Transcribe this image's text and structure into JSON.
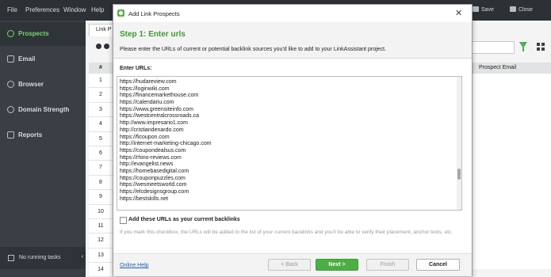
{
  "menu": {
    "file": "File",
    "preferences": "Preferences",
    "window": "Window",
    "help": "Help"
  },
  "topbar": {
    "save": "Save",
    "close": "Close"
  },
  "sidebar": {
    "items": [
      {
        "label": "Prospects",
        "icon": "prospects-icon",
        "active": true
      },
      {
        "label": "Email",
        "icon": "email-icon"
      },
      {
        "label": "Browser",
        "icon": "browser-icon"
      },
      {
        "label": "Domain Strength",
        "icon": "domain-strength-icon"
      },
      {
        "label": "Reports",
        "icon": "reports-icon"
      }
    ],
    "status": "No running tasks"
  },
  "main": {
    "tab": "Link P",
    "col_num": "#",
    "col_prospect_email": "Prospect Email",
    "rows": [
      "1",
      "2",
      "3",
      "4",
      "5",
      "6",
      "7",
      "8",
      "9",
      "10",
      "11",
      "12",
      "13",
      "14"
    ]
  },
  "dialog": {
    "title": "Add Link Prospects",
    "step": "Step 1: Enter urls",
    "description": "Please enter the URLs of current or potential backlink sources you'd like to add to your LinkAssistant project.",
    "urls_label": "Enter URLs:",
    "urls": [
      "https://hudareview.com",
      "https://loginwiki.com",
      "https://financemarkethouse.com",
      "https://calendariu.com",
      "https://www.greensiteinfo.com",
      "https://westcentralcrossroads.ca",
      "http://www.impresario1.com",
      "http://cristiandenardo.com",
      "https://ficoupon.com",
      "http://internet-marketing-chicago.com",
      "https://coupondealsus.com",
      "https://rhino-reviews.com",
      "http://evangelist.news",
      "https://homebasedigital.com",
      "https://couponpuzzles.com",
      "https://wesmeetsworld.com",
      "https://elcdesignsgroup.com",
      "https://bestskills.net"
    ],
    "checkbox_label": "Add these URLs as your current backlinks",
    "checkbox_checked": false,
    "note": "If you mark this checkbox, the URLs will be added to the list of your current backlinks and you'll be able to verify their placement, anchor texts, etc.",
    "help_link": "Online Help",
    "back": "< Back",
    "next": "Next >",
    "finish": "Finish",
    "cancel": "Cancel"
  },
  "colors": {
    "accent_green": "#4caf43",
    "step_green": "#3f9a34",
    "sidebar_bg": "#3a3f45"
  }
}
